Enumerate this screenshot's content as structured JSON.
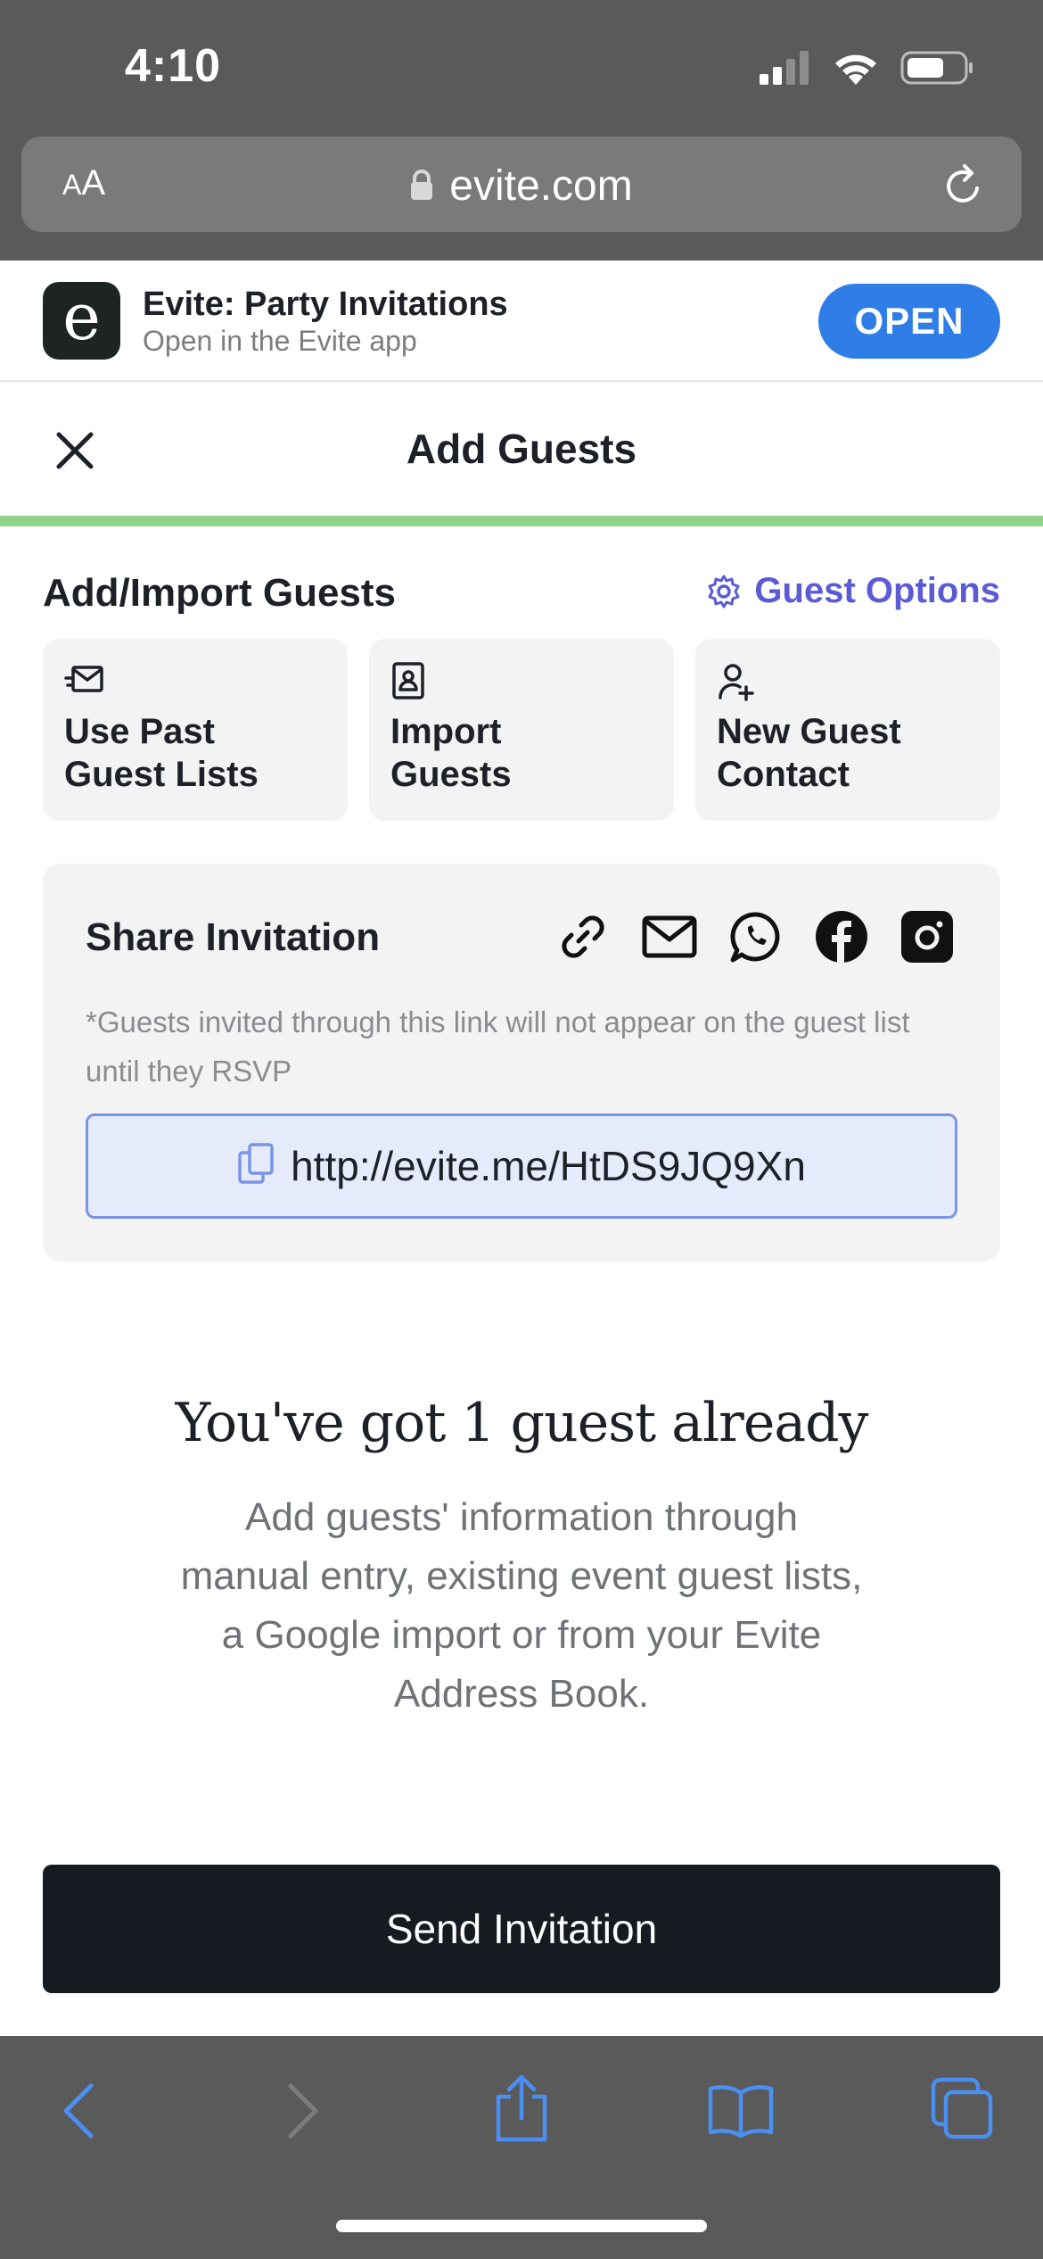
{
  "status_bar": {
    "time": "4:10"
  },
  "browser": {
    "aa_label_small": "A",
    "aa_label_large": "A",
    "url": "evite.com"
  },
  "app_banner": {
    "logo_letter": "e",
    "app_name": "Evite: Party Invitations",
    "subtitle": "Open in the Evite app",
    "open_label": "OPEN"
  },
  "header": {
    "title": "Add Guests"
  },
  "add_import": {
    "title": "Add/Import Guests",
    "guest_options_label": "Guest Options",
    "cards": [
      {
        "line1": "Use Past",
        "line2": "Guest Lists",
        "icon": "envelope-send-icon"
      },
      {
        "line1": "Import",
        "line2": "Guests",
        "icon": "contact-book-icon"
      },
      {
        "line1": "New Guest",
        "line2": "Contact",
        "icon": "add-person-icon"
      }
    ]
  },
  "share": {
    "title": "Share Invitation",
    "note": "*Guests invited through this link will not appear on the guest list until they RSVP",
    "link": "http://evite.me/HtDS9JQ9Xn",
    "icons": [
      "link-icon",
      "mail-icon",
      "whatsapp-icon",
      "facebook-icon",
      "instagram-icon"
    ]
  },
  "empty_state": {
    "title": "You've got 1 guest already",
    "description": "Add guests' information through manual entry, existing event guest lists, a Google import or from your Evite Address Book."
  },
  "send_button": {
    "label": "Send Invitation"
  },
  "colors": {
    "accent": "#5b5bd6",
    "open_button": "#2f7de6",
    "progress": "#8fd489",
    "primary_button": "#161b22",
    "safari_chrome": "#5a5a5b"
  }
}
